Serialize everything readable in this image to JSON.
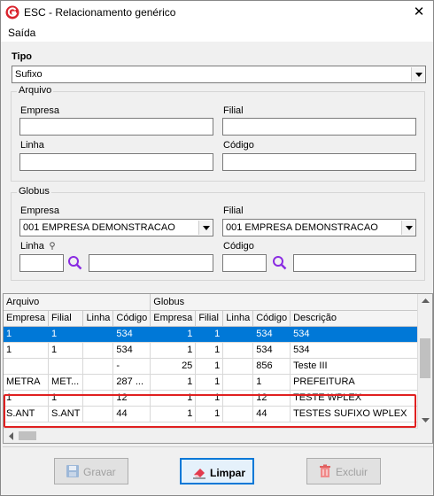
{
  "window": {
    "title": "ESC - Relacionamento genérico",
    "close_glyph": "✕"
  },
  "menu": {
    "items": [
      "Saída"
    ]
  },
  "tipo": {
    "label": "Tipo",
    "value": "Sufixo"
  },
  "arquivo": {
    "group_label": "Arquivo",
    "empresa_label": "Empresa",
    "filial_label": "Filial",
    "linha_label": "Linha",
    "codigo_label": "Código",
    "empresa_value": "",
    "filial_value": "",
    "linha_value": "",
    "codigo_value": ""
  },
  "globus": {
    "group_label": "Globus",
    "empresa_label": "Empresa",
    "empresa_value": "001 EMPRESA DEMONSTRACAO",
    "filial_label": "Filial",
    "filial_value": "001 EMPRESA DEMONSTRACAO",
    "linha_label": "Linha",
    "codigo_label": "Código",
    "linha_value": "",
    "codigo_value": ""
  },
  "grid": {
    "group_headers": [
      "Arquivo",
      "Globus"
    ],
    "columns": [
      "Empresa",
      "Filial",
      "Linha",
      "Código",
      "Empresa",
      "Filial",
      "Linha",
      "Código",
      "Descrição"
    ],
    "rows": [
      [
        "1",
        "1",
        "",
        "534",
        "1",
        "1",
        "",
        "534",
        "534"
      ],
      [
        "1",
        "1",
        "",
        "534",
        "1",
        "1",
        "",
        "534",
        "534"
      ],
      [
        "",
        "",
        "",
        "-",
        "25",
        "1",
        "",
        "856",
        "Teste III"
      ],
      [
        "METRA",
        "MET...",
        "",
        "287 ...",
        "1",
        "1",
        "",
        "1",
        "PREFEITURA"
      ],
      [
        "1",
        "1",
        "",
        "12",
        "1",
        "1",
        "",
        "12",
        "TESTE WPLEX"
      ],
      [
        "S.ANT",
        "S.ANT",
        "",
        "44",
        "1",
        "1",
        "",
        "44",
        "TESTES SUFIXO WPLEX"
      ]
    ],
    "selected_row": 0
  },
  "buttons": {
    "gravar": "Gravar",
    "limpar": "Limpar",
    "excluir": "Excluir"
  },
  "colors": {
    "selection": "#0078d7",
    "highlight": "#e02020",
    "accent": "#0078d7"
  },
  "icons": [
    "app-logo-icon",
    "close-icon",
    "search-icon",
    "save-icon",
    "eraser-icon",
    "trash-icon",
    "pin-icon"
  ]
}
